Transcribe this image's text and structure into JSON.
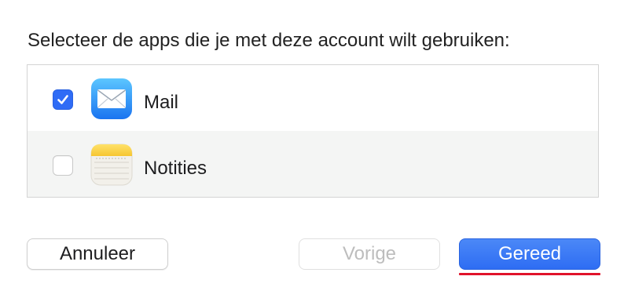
{
  "dialog": {
    "prompt": "Selecteer de apps die je met deze account wilt gebruiken:"
  },
  "apps": [
    {
      "label": "Mail",
      "icon": "mail-app-icon",
      "checked": true
    },
    {
      "label": "Notities",
      "icon": "notes-app-icon",
      "checked": false
    }
  ],
  "buttons": {
    "cancel": "Annuleer",
    "back": "Vorige",
    "done": "Gereed"
  },
  "colors": {
    "accent": "#2f6cf6",
    "annotation_underline": "#e0122a"
  }
}
